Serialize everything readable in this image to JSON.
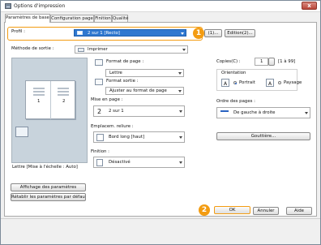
{
  "window": {
    "title": "Options d'impression",
    "close": "x"
  },
  "tabs": [
    "Paramètres de base",
    "Configuration page",
    "Finition",
    "Qualité"
  ],
  "profile": {
    "label": "Profil :",
    "value": "2 sur 1 [Recto]",
    "button_edit_suffix": "(1)...",
    "button_edit": "Edition(2)..."
  },
  "output_method": {
    "label": "Méthode de sortie :",
    "value": "Imprimer"
  },
  "preview": {
    "caption": "Lettre [Mise à l'échelle : Auto]",
    "page_numbers": [
      "1",
      "2"
    ]
  },
  "page_format": {
    "label": "Format de page :",
    "value": "Lettre"
  },
  "output_format": {
    "label": "Format sortie :",
    "value": "Ajuster au format de page"
  },
  "layout": {
    "label": "Mise en page :",
    "value": "2 sur 1",
    "icon_number": "2"
  },
  "binding": {
    "label": "Emplacem. reliure :",
    "value": "Bord long [haut]"
  },
  "finishing": {
    "label": "Finition :",
    "value": "Désactivé"
  },
  "copies": {
    "label": "Copies(C) :",
    "value": "1",
    "range": "[1 à 99]"
  },
  "orientation": {
    "label": "Orientation",
    "portrait": "Portrait",
    "landscape": "Paysage",
    "portrait_icon": "A",
    "landscape_icon": "A"
  },
  "page_order": {
    "label": "Ordre des pages :",
    "value": "De gauche à droite"
  },
  "gutter_button": "Gouttière...",
  "settings_display_button": "Affichage des paramètres",
  "restore_defaults_button": "Rétablir les paramètres par défaut",
  "dialog_buttons": {
    "ok": "OK",
    "cancel": "Annuler",
    "help": "Aide"
  },
  "badges": {
    "one": "1",
    "two": "2"
  },
  "accent_colors": {
    "orange": "#f39c12",
    "selection": "#2f78d0"
  }
}
